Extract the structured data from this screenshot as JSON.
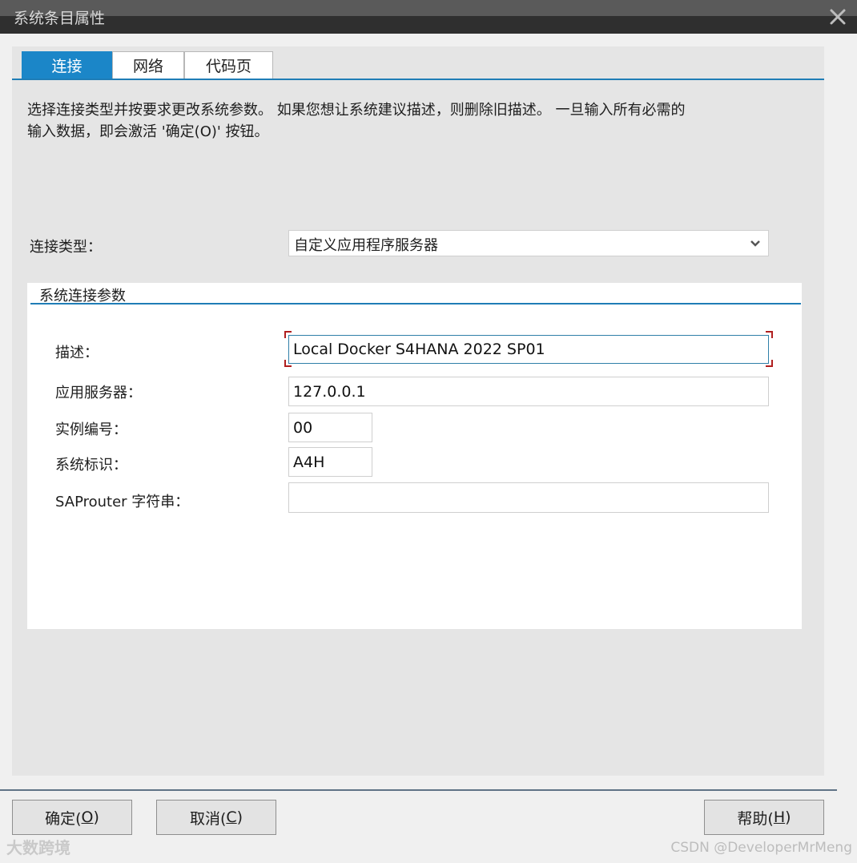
{
  "window": {
    "title": "系统条目属性"
  },
  "tabs": [
    {
      "label": "连接",
      "active": true
    },
    {
      "label": "网络",
      "active": false
    },
    {
      "label": "代码页",
      "active": false
    }
  ],
  "description_line1": "选择连接类型并按要求更改系统参数。 如果您想让系统建议描述，则删除旧描述。 一旦输入所有必需的",
  "description_line2": "输入数据，即会激活 '确定(O)' 按钮。",
  "connection_type": {
    "label": "连接类型：",
    "value": "自定义应用程序服务器"
  },
  "group": {
    "title": "系统连接参数",
    "fields": {
      "description": {
        "label": "描述：",
        "value": "Local Docker S4HANA 2022 SP01"
      },
      "app_server": {
        "label": "应用服务器：",
        "value": "127.0.0.1"
      },
      "instance_number": {
        "label": "实例编号：",
        "value": "00"
      },
      "system_id": {
        "label": "系统标识：",
        "value": "A4H"
      },
      "saprouter": {
        "label": "SAProuter 字符串：",
        "value": ""
      }
    }
  },
  "buttons": {
    "ok": {
      "text": "确定(",
      "mnemonic": "O",
      "suffix": ")"
    },
    "cancel": {
      "text": "取消(",
      "mnemonic": "C",
      "suffix": ")"
    },
    "help": {
      "text": "帮助(",
      "mnemonic": "H",
      "suffix": ")"
    }
  },
  "watermarks": {
    "left": "大数跨境",
    "right": "CSDN @DeveloperMrMeng"
  },
  "colors": {
    "accent": "#1b86c8",
    "titlebar": "#2f2f2f",
    "focus_corner": "#b01f1f"
  },
  "icons": {
    "close": "close-icon",
    "dropdown": "chevron-down-icon"
  }
}
